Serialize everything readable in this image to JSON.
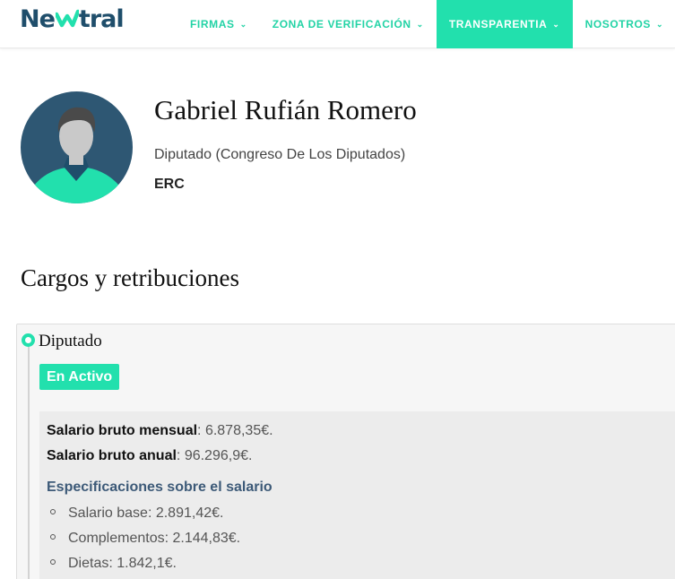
{
  "header": {
    "logo": {
      "pre": "Ne",
      "post": "tral"
    },
    "nav": [
      {
        "label": "FIRMAS"
      },
      {
        "label": "ZONA DE VERIFICACIÓN"
      },
      {
        "label": "TRANSPARENTIA"
      },
      {
        "label": "NOSOTROS"
      }
    ],
    "active_index": 2
  },
  "profile": {
    "name": "Gabriel Rufián Romero",
    "role": "Diputado",
    "institution": "(Congreso De Los Diputados)",
    "party": "ERC"
  },
  "section": {
    "title": "Cargos y retribuciones"
  },
  "position": {
    "title": "Diputado",
    "status": "En Activo",
    "salary_monthly_label": "Salario bruto mensual",
    "salary_monthly_value": ": 6.878,35€.",
    "salary_annual_label": "Salario bruto anual",
    "salary_annual_value": ": 96.296,9€.",
    "spec_title": "Especificaciones sobre el salario",
    "specs": [
      {
        "text": "Salario base: 2.891,42€."
      },
      {
        "text": "Complementos: 2.144,83€."
      },
      {
        "text": "Dietas: 1.842,1€."
      }
    ]
  },
  "colors": {
    "accent": "#22e0ad",
    "brand_dark": "#1f4e6b",
    "avatar_bg": "#2e5773",
    "spec_title": "#3d5a78"
  }
}
